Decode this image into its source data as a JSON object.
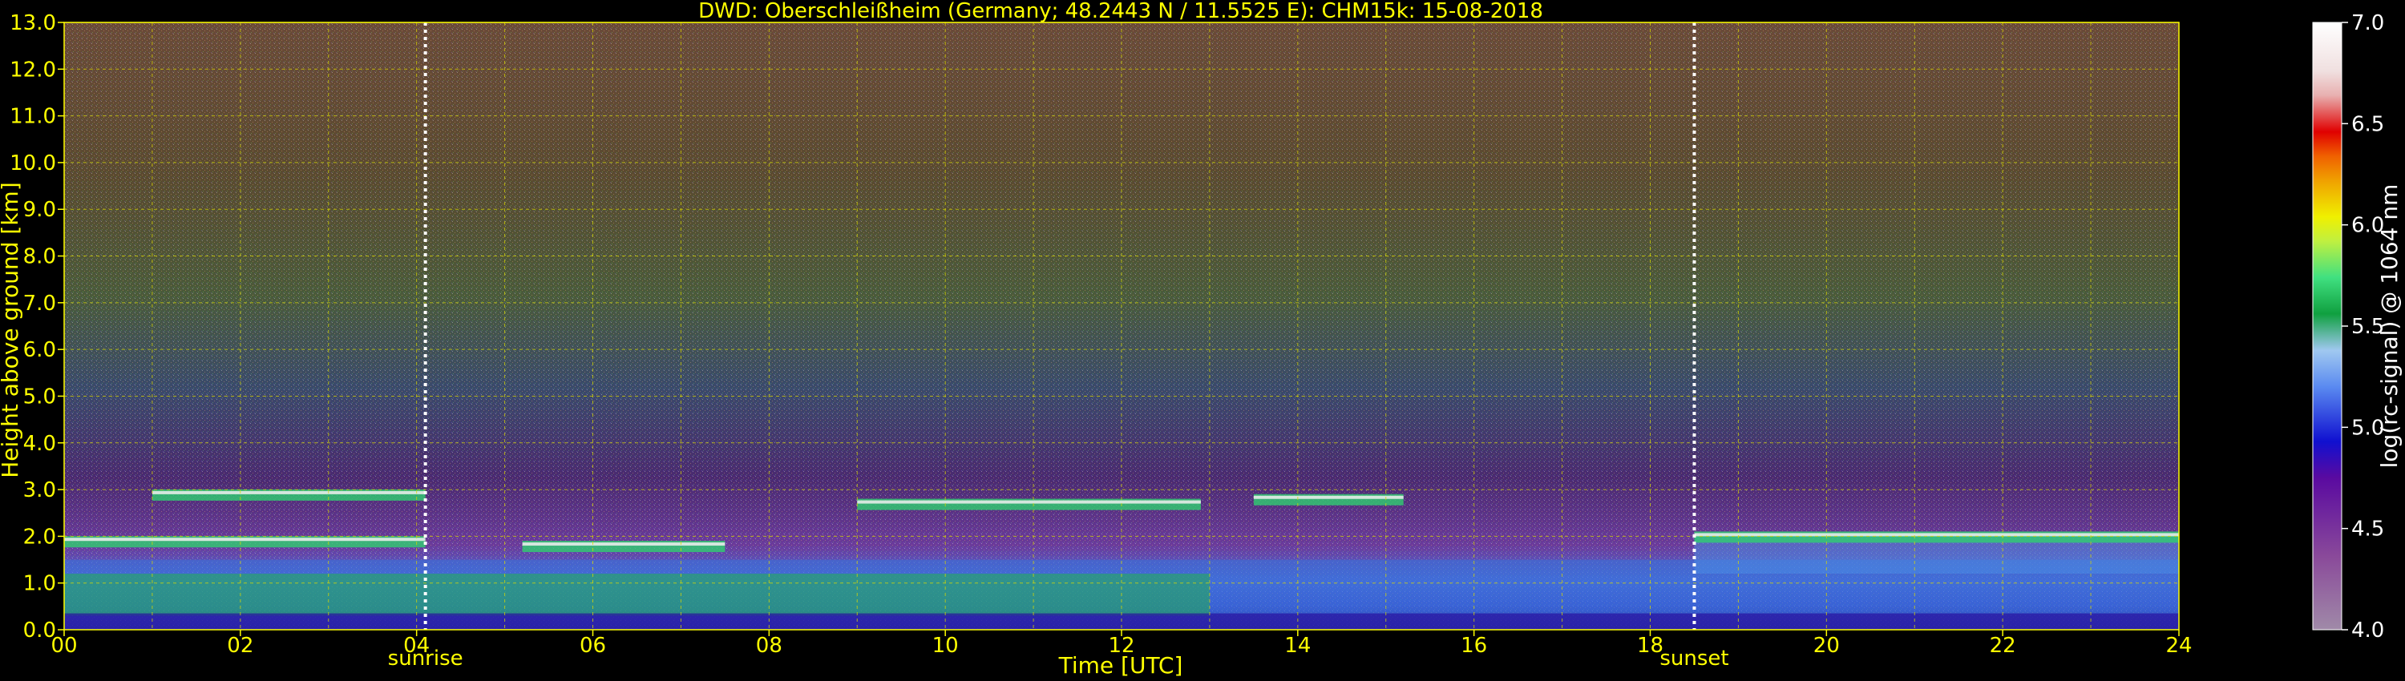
{
  "chart_data": {
    "type": "heatmap",
    "title": "DWD: Oberschleißheim (Germany; 48.2443 N / 11.5525 E):    CHM15k: 15-08-2018",
    "xlabel": "Time [UTC]",
    "ylabel": "Height above ground [km]",
    "xlim": [
      0,
      24
    ],
    "ylim": [
      0,
      13
    ],
    "x_ticks": [
      "00",
      "02",
      "04",
      "06",
      "08",
      "10",
      "12",
      "14",
      "16",
      "18",
      "20",
      "22",
      "24"
    ],
    "y_ticks": [
      "0.0",
      "1.0",
      "2.0",
      "3.0",
      "4.0",
      "5.0",
      "6.0",
      "7.0",
      "8.0",
      "9.0",
      "10.0",
      "11.0",
      "12.0",
      "13.0"
    ],
    "grid": true,
    "events": [
      {
        "label": "sunrise",
        "time_utc": 4.1
      },
      {
        "label": "sunset",
        "time_utc": 18.5
      }
    ],
    "colorbar": {
      "label": "log(rc-signal) @ 1064 nm",
      "range": [
        4.0,
        7.0
      ],
      "ticks": [
        "4.0",
        "4.5",
        "5.0",
        "5.5",
        "6.0",
        "6.5",
        "7.0"
      ],
      "placement": "right"
    },
    "cloud_layers": [
      {
        "start": 0.0,
        "end": 4.1,
        "height_km": 1.9
      },
      {
        "start": 1.0,
        "end": 4.1,
        "height_km": 2.9
      },
      {
        "start": 5.2,
        "end": 7.5,
        "height_km": 1.8
      },
      {
        "start": 9.0,
        "end": 12.9,
        "height_km": 2.7
      },
      {
        "start": 13.5,
        "end": 15.2,
        "height_km": 2.8
      },
      {
        "start": 18.5,
        "end": 24.0,
        "height_km": 2.0
      }
    ]
  }
}
